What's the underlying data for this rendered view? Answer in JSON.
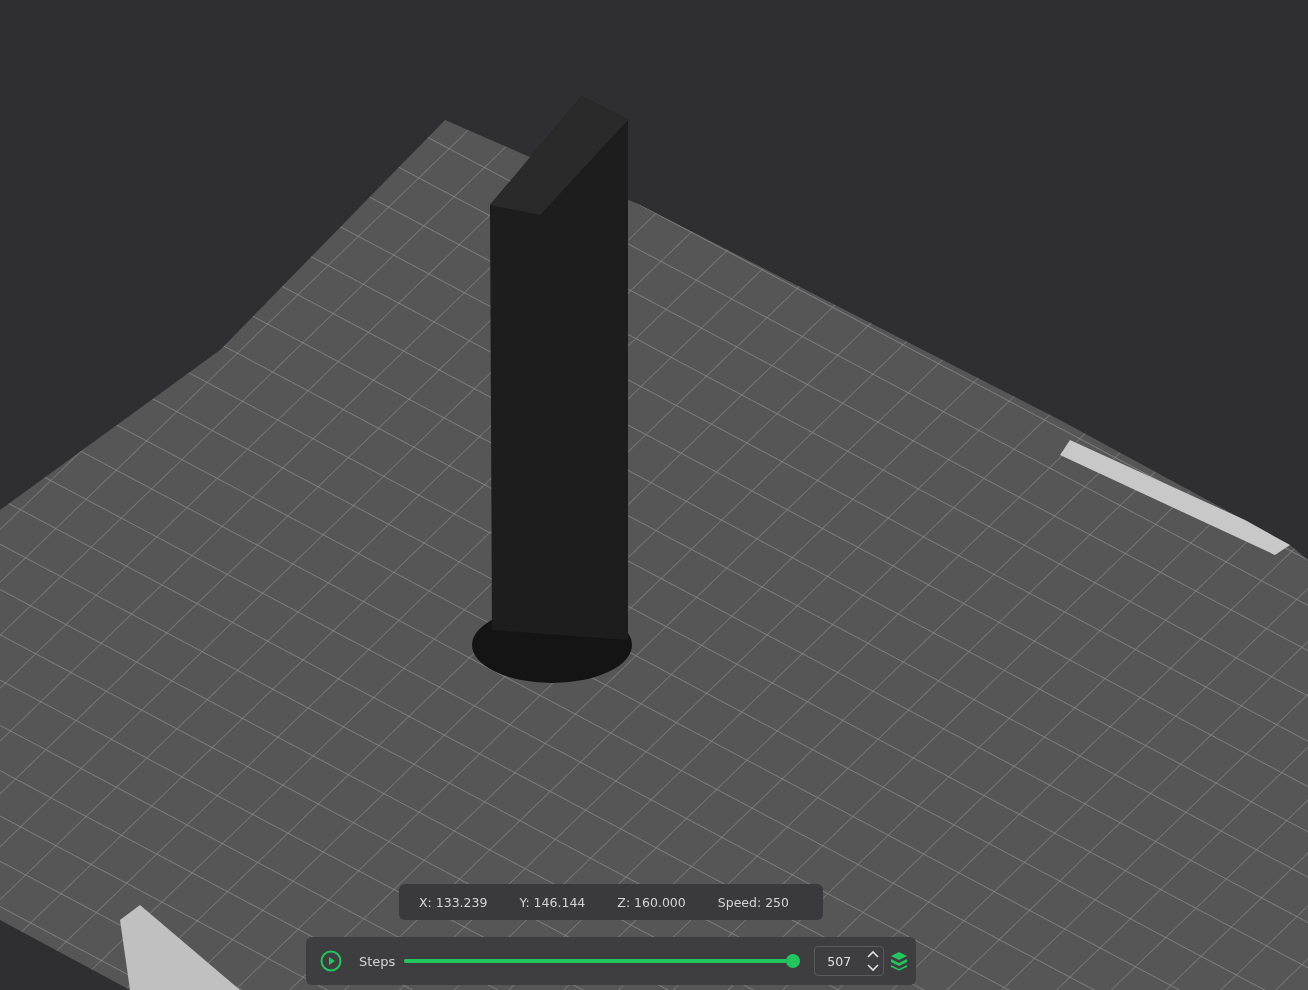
{
  "position_readout": [
    "X: 133.239",
    "Y: 146.144",
    "Z: 160.000",
    "Speed: 250"
  ],
  "playback": {
    "label": "Steps",
    "level": 1,
    "value": "507"
  }
}
